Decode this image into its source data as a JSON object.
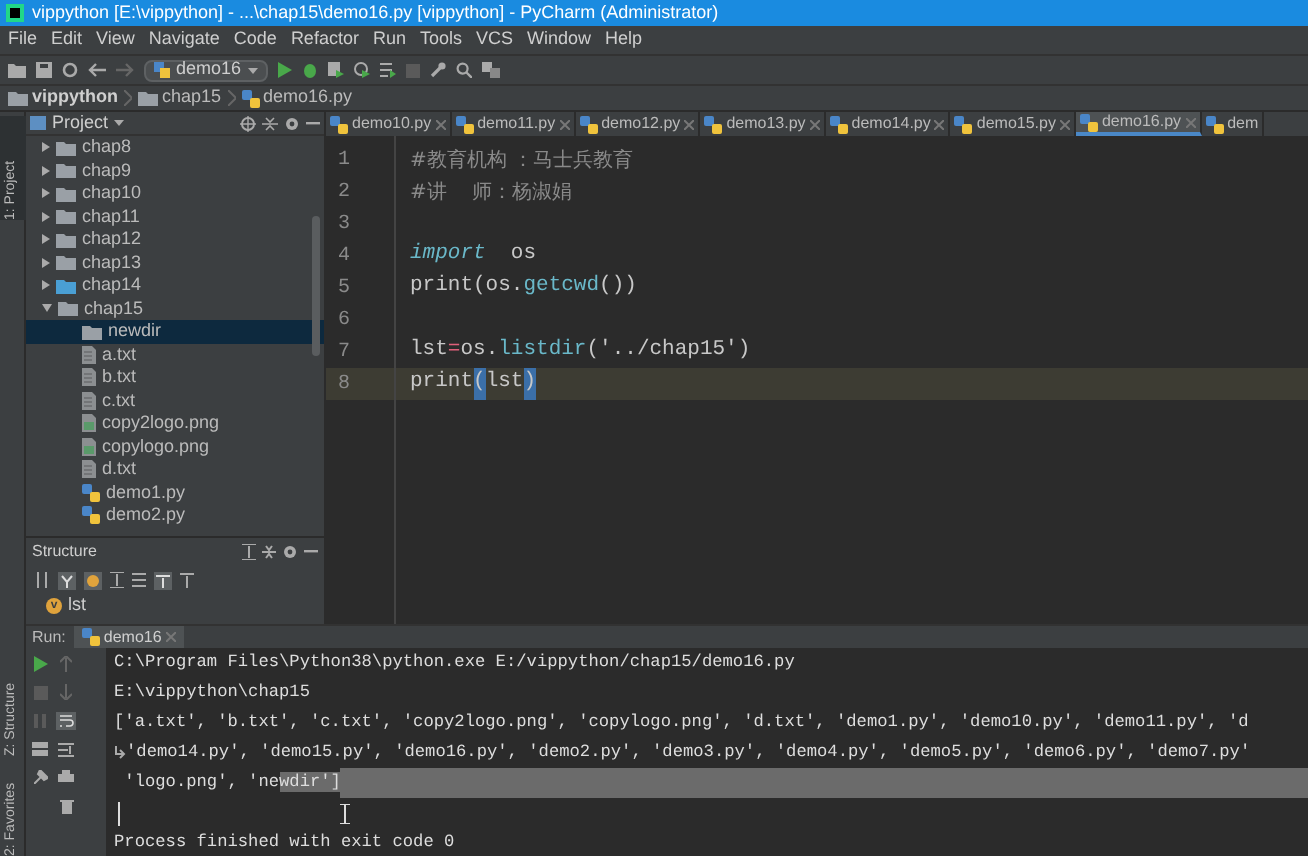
{
  "window": {
    "title": "vippython [E:\\vippython] - ...\\chap15\\demo16.py [vippython] - PyCharm (Administrator)"
  },
  "menu": [
    "File",
    "Edit",
    "View",
    "Navigate",
    "Code",
    "Refactor",
    "Run",
    "Tools",
    "VCS",
    "Window",
    "Help"
  ],
  "toolbar": {
    "run_config": "demo16"
  },
  "breadcrumbs": [
    {
      "label": "vippython",
      "kind": "folder"
    },
    {
      "label": "chap15",
      "kind": "folder"
    },
    {
      "label": "demo16.py",
      "kind": "py"
    }
  ],
  "side_stripe": [
    "1: Project",
    "Z: Structure",
    "2: Favorites"
  ],
  "project": {
    "title": "Project",
    "tree": [
      {
        "label": "chap8",
        "kind": "folder",
        "expanded": false,
        "selected": false
      },
      {
        "label": "chap9",
        "kind": "folder",
        "expanded": false,
        "selected": false
      },
      {
        "label": "chap10",
        "kind": "folder",
        "expanded": false,
        "selected": false
      },
      {
        "label": "chap11",
        "kind": "folder",
        "expanded": false,
        "selected": false
      },
      {
        "label": "chap12",
        "kind": "folder",
        "expanded": false,
        "selected": false
      },
      {
        "label": "chap13",
        "kind": "folder",
        "expanded": false,
        "selected": false
      },
      {
        "label": "chap14",
        "kind": "folder",
        "expanded": false,
        "selected": false,
        "color": "#4a9fd4"
      },
      {
        "label": "chap15",
        "kind": "folder",
        "expanded": true,
        "selected": false,
        "children": [
          {
            "label": "newdir",
            "kind": "folder",
            "selected": true
          },
          {
            "label": "a.txt",
            "kind": "text",
            "selected": false
          },
          {
            "label": "b.txt",
            "kind": "text",
            "selected": false
          },
          {
            "label": "c.txt",
            "kind": "text",
            "selected": false
          },
          {
            "label": "copy2logo.png",
            "kind": "image",
            "selected": false
          },
          {
            "label": "copylogo.png",
            "kind": "image",
            "selected": false
          },
          {
            "label": "d.txt",
            "kind": "text",
            "selected": false
          },
          {
            "label": "demo1.py",
            "kind": "py",
            "selected": false
          },
          {
            "label": "demo2.py",
            "kind": "py",
            "selected": false
          }
        ]
      }
    ]
  },
  "structure": {
    "title": "Structure",
    "items": [
      {
        "label": "lst",
        "badge": "v"
      }
    ]
  },
  "editor": {
    "tabs": [
      {
        "label": "demo10.py",
        "selected": false
      },
      {
        "label": "demo11.py",
        "selected": false
      },
      {
        "label": "demo12.py",
        "selected": false
      },
      {
        "label": "demo13.py",
        "selected": false
      },
      {
        "label": "demo14.py",
        "selected": false
      },
      {
        "label": "demo15.py",
        "selected": false
      },
      {
        "label": "demo16.py",
        "selected": true
      },
      {
        "label": "dem",
        "selected": false
      }
    ],
    "lines": [
      {
        "number": "1",
        "current": false,
        "tokens": [
          {
            "text": "#教育机构 ：马士兵教育",
            "kind": "comment"
          }
        ]
      },
      {
        "number": "2",
        "current": false,
        "tokens": [
          {
            "text": "#讲    师：杨淑娟",
            "kind": "comment"
          }
        ]
      },
      {
        "number": "3",
        "current": false
      },
      {
        "number": "4",
        "current": false,
        "tokens": [
          {
            "text": "import",
            "kind": "keyword"
          },
          {
            "text": "  os",
            "kind": "plain"
          }
        ]
      },
      {
        "number": "5",
        "current": false,
        "tokens": [
          {
            "text": "print(os.",
            "kind": "plain"
          },
          {
            "text": "getcwd",
            "kind": "call"
          },
          {
            "text": "())",
            "kind": "plain"
          }
        ]
      },
      {
        "number": "6",
        "current": false
      },
      {
        "number": "7",
        "current": false,
        "tokens": [
          {
            "text": "lst",
            "kind": "plain"
          },
          {
            "text": "=",
            "kind": "operator"
          },
          {
            "text": "os.",
            "kind": "plain"
          },
          {
            "text": "listdir",
            "kind": "call"
          },
          {
            "text": "('../chap15')",
            "kind": "plain"
          }
        ]
      },
      {
        "number": "8",
        "current": true,
        "tokens": [
          {
            "text": "print",
            "kind": "plain"
          },
          {
            "text": "(",
            "kind": "match"
          },
          {
            "text": "lst",
            "kind": "plain"
          },
          {
            "text": ")",
            "kind": "match"
          }
        ]
      }
    ]
  },
  "run": {
    "label": "Run:",
    "tab": "demo16",
    "output": [
      {
        "text": "C:\\Program Files\\Python38\\python.exe E:/vippython/chap15/demo16.py",
        "wrapped": false,
        "kind": "command"
      },
      {
        "text": "E:\\vippython\\chap15",
        "wrapped": false,
        "kind": "plain"
      },
      {
        "text": "['a.txt', 'b.txt', 'c.txt', 'copy2logo.png', 'copylogo.png', 'd.txt', 'demo1.py', 'demo10.py', 'demo11.py', 'd",
        "wrapped": false,
        "kind": "plain"
      },
      {
        "text": "'demo14.py', 'demo15.py', 'demo16.py', 'demo2.py', 'demo3.py', 'demo4.py', 'demo5.py', 'demo6.py', 'demo7.py'",
        "wrapped": true,
        "kind": "plain"
      },
      {
        "text": " 'logo.png', 'ne",
        "wrapped": false,
        "kind": "plain",
        "selected_text": "wdir']"
      },
      {
        "kind": "cursor"
      },
      {
        "text": "Process finished with exit code 0",
        "wrapped": false,
        "kind": "plain"
      }
    ]
  }
}
